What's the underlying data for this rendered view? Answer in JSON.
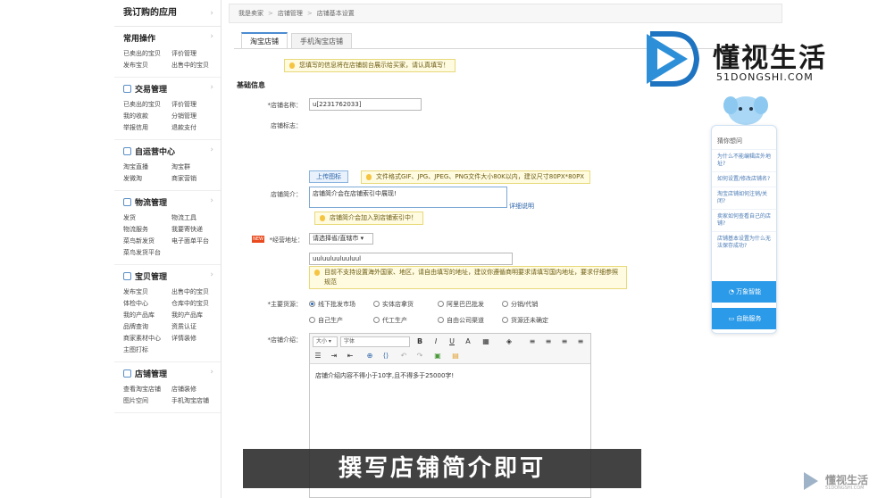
{
  "sidebar": {
    "header": "我订购的应用",
    "groups": [
      {
        "title": "常用操作",
        "links": [
          "已卖出的宝贝",
          "评价管理",
          "发布宝贝",
          "出售中的宝贝"
        ]
      },
      {
        "title": "交易管理",
        "links": [
          "已卖出的宝贝",
          "评价管理",
          "我的收款",
          "分销管理",
          "举报信用",
          "退款支付"
        ]
      },
      {
        "title": "自运营中心",
        "links": [
          "淘宝直播",
          "淘宝群",
          "发微淘",
          "商家营销"
        ]
      },
      {
        "title": "物流管理",
        "links": [
          "发货",
          "物流工具",
          "物流服务",
          "我要寄快递",
          "菜鸟新发货",
          "电子面单平台",
          "菜鸟发货平台"
        ]
      },
      {
        "title": "宝贝管理",
        "links": [
          "发布宝贝",
          "出售中的宝贝",
          "体检中心",
          "仓库中的宝贝",
          "我的产品库",
          "我的产品库",
          "品牌查询",
          "资质认证",
          "商家素材中心",
          "详情装修",
          "主图打标"
        ]
      },
      {
        "title": "店铺管理",
        "links": [
          "查看淘宝店铺",
          "店铺装修",
          "图片空间",
          "手机淘宝店铺"
        ]
      }
    ]
  },
  "breadcrumb": [
    "我是卖家",
    "店铺管理",
    "店铺基本设置"
  ],
  "tabs": [
    "淘宝店铺",
    "手机淘宝店铺"
  ],
  "notice_top": "您填写的信息将在店铺前台展示给买家，请认真填写！",
  "section_title": "基础信息",
  "form": {
    "shop_name_label": "*店铺名称：",
    "shop_name_value": "u[2231762033]",
    "shop_logo_label": "店铺标志：",
    "upload_button": "上传图标",
    "upload_hint": "文件格式GIF、JPG、JPEG、PNG文件大小80K以内，建议尺寸80PX*80PX",
    "intro_label": "店铺简介：",
    "intro_value": "店铺简介会在店铺索引中展现!",
    "intro_link": "详细说明",
    "intro_notice": "店铺简介会加入到店铺索引中！",
    "address_label": "*经营地址：",
    "address_select": "请选择省/直辖市",
    "address_value": "uuluuluuluuluul",
    "address_notice": "目前不支持设置海外国家、地区，请自由填写的地址，建议你遵循商明要求请填写国内地址，要求仔细参照规范",
    "source_label": "*主要货源：",
    "radios": [
      "线下批发市场",
      "实体店拿货",
      "阿里巴巴批发",
      "分销/代销",
      "自己生产",
      "代工生产",
      "自由公司渠道",
      "货源还未确定"
    ],
    "detail_label": "*店铺介绍：",
    "font_size": "大小",
    "font_family": "字体",
    "editor_text": "店铺介绍内容不得小于10字,且不得多于25000字!"
  },
  "new_badge": "NEW",
  "logo": {
    "title": "懂视生活",
    "subtitle": "51DONGSHI.COM"
  },
  "help": {
    "title": "猜你想问",
    "questions": [
      "为什么不能编辑店外地址?",
      "如何设置/修改店铺名?",
      "淘宝店铺如何注销/关闭?",
      "卖家如何查看自己的店铺?",
      "店铺基本设置为什么无法保存成功?"
    ],
    "btn1": "万象智能",
    "btn2": "自助服务"
  },
  "subtitle": "撰写店铺简介即可",
  "watermark": {
    "title": "懂视生活",
    "subtitle": "51DONGSHI.COM"
  }
}
